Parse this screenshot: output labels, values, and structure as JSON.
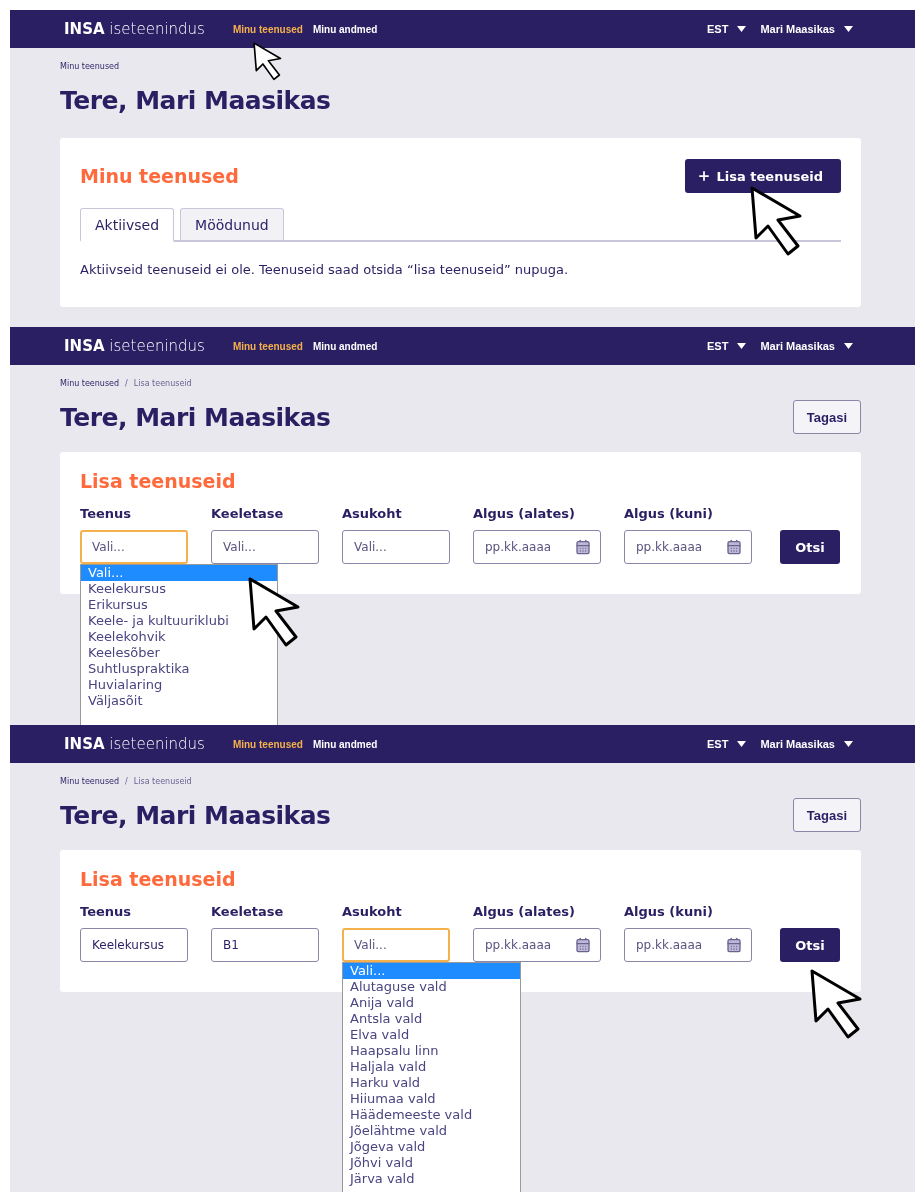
{
  "screens": [
    {
      "nav": {
        "brand_bold": "INSA",
        "brand": "iseteenindus",
        "links": [
          {
            "label": "Minu teenused",
            "selected": true
          },
          {
            "label": "Minu andmed",
            "selected": false
          }
        ],
        "language": "EST",
        "user": "Mari Maasikas"
      },
      "breadcrumb": {
        "items": [
          "Minu teenused"
        ]
      },
      "title": "Tere, Mari Maasikas",
      "card": {
        "kind": "services",
        "heading": "Minu teenused",
        "add_button": "Lisa teenuseid",
        "tabs": [
          {
            "label": "Aktiivsed",
            "selected": true
          },
          {
            "label": "Möödunud",
            "selected": false
          }
        ],
        "message": "Aktiivseid teenuseid ei ole. Teenuseid saad otsida “lisa teenuseid” nupuga."
      }
    },
    {
      "nav": {
        "brand_bold": "INSA",
        "brand": "iseteenindus",
        "links": [
          {
            "label": "Minu teenused",
            "selected": true
          },
          {
            "label": "Minu andmed",
            "selected": false
          }
        ],
        "language": "EST",
        "user": "Mari Maasikas"
      },
      "breadcrumb": {
        "separator": "/",
        "items": [
          "Minu teenused",
          "Lisa teenuseid"
        ]
      },
      "title": "Tere, Mari Maasikas",
      "back_button": "Tagasi",
      "card": {
        "kind": "search",
        "heading": "Lisa teenuseid",
        "search_button": "Otsi",
        "fields": [
          {
            "kind": "select",
            "label": "Teenus",
            "placeholder": "Vali...",
            "focused": true,
            "options": [
              {
                "label": "Vali...",
                "selected": true
              },
              {
                "label": "Keelekursus",
                "selected": false
              },
              {
                "label": "Erikursus",
                "selected": false
              },
              {
                "label": "Keele- ja kultuuriklubi",
                "selected": false
              },
              {
                "label": "Keelekohvik",
                "selected": false
              },
              {
                "label": "Keelesõber",
                "selected": false
              },
              {
                "label": "Suhtluspraktika",
                "selected": false
              },
              {
                "label": "Huvialaring",
                "selected": false
              },
              {
                "label": "Väljasõit",
                "selected": false
              }
            ]
          },
          {
            "kind": "select",
            "label": "Keeletase",
            "placeholder": "Vali...",
            "focused": false
          },
          {
            "kind": "select",
            "label": "Asukoht",
            "placeholder": "Vali...",
            "focused": false
          },
          {
            "kind": "date",
            "label": "Algus (alates)",
            "placeholder": "pp.kk.aaaa",
            "focused": false
          },
          {
            "kind": "date",
            "label": "Algus (kuni)",
            "placeholder": "pp.kk.aaaa",
            "focused": false
          }
        ]
      }
    },
    {
      "nav": {
        "brand_bold": "INSA",
        "brand": "iseteenindus",
        "links": [
          {
            "label": "Minu teenused",
            "selected": true
          },
          {
            "label": "Minu andmed",
            "selected": false
          }
        ],
        "language": "EST",
        "user": "Mari Maasikas"
      },
      "breadcrumb": {
        "separator": "/",
        "items": [
          "Minu teenused",
          "Lisa teenuseid"
        ]
      },
      "title": "Tere, Mari Maasikas",
      "back_button": "Tagasi",
      "card": {
        "kind": "search",
        "heading": "Lisa teenuseid",
        "search_button": "Otsi",
        "fields": [
          {
            "kind": "select",
            "label": "Teenus",
            "value": "Keelekursus",
            "focused": false
          },
          {
            "kind": "select",
            "label": "Keeletase",
            "value": "B1",
            "focused": false
          },
          {
            "kind": "select",
            "label": "Asukoht",
            "placeholder": "Vali...",
            "focused": true,
            "options": [
              {
                "label": "Vali...",
                "selected": true
              },
              {
                "label": "Alutaguse vald",
                "selected": false
              },
              {
                "label": "Anija vald",
                "selected": false
              },
              {
                "label": "Antsla vald",
                "selected": false
              },
              {
                "label": "Elva vald",
                "selected": false
              },
              {
                "label": "Haapsalu linn",
                "selected": false
              },
              {
                "label": "Haljala vald",
                "selected": false
              },
              {
                "label": "Harku vald",
                "selected": false
              },
              {
                "label": "Hiiumaa vald",
                "selected": false
              },
              {
                "label": "Häädemeeste vald",
                "selected": false
              },
              {
                "label": "Jõelähtme vald",
                "selected": false
              },
              {
                "label": "Jõgeva vald",
                "selected": false
              },
              {
                "label": "Jõhvi vald",
                "selected": false
              },
              {
                "label": "Järva vald",
                "selected": false
              }
            ]
          },
          {
            "kind": "date",
            "label": "Algus (alates)",
            "placeholder": "pp.kk.aaaa",
            "focused": false
          },
          {
            "kind": "date",
            "label": "Algus (kuni)",
            "placeholder": "pp.kk.aaaa",
            "focused": false
          }
        ]
      }
    }
  ]
}
